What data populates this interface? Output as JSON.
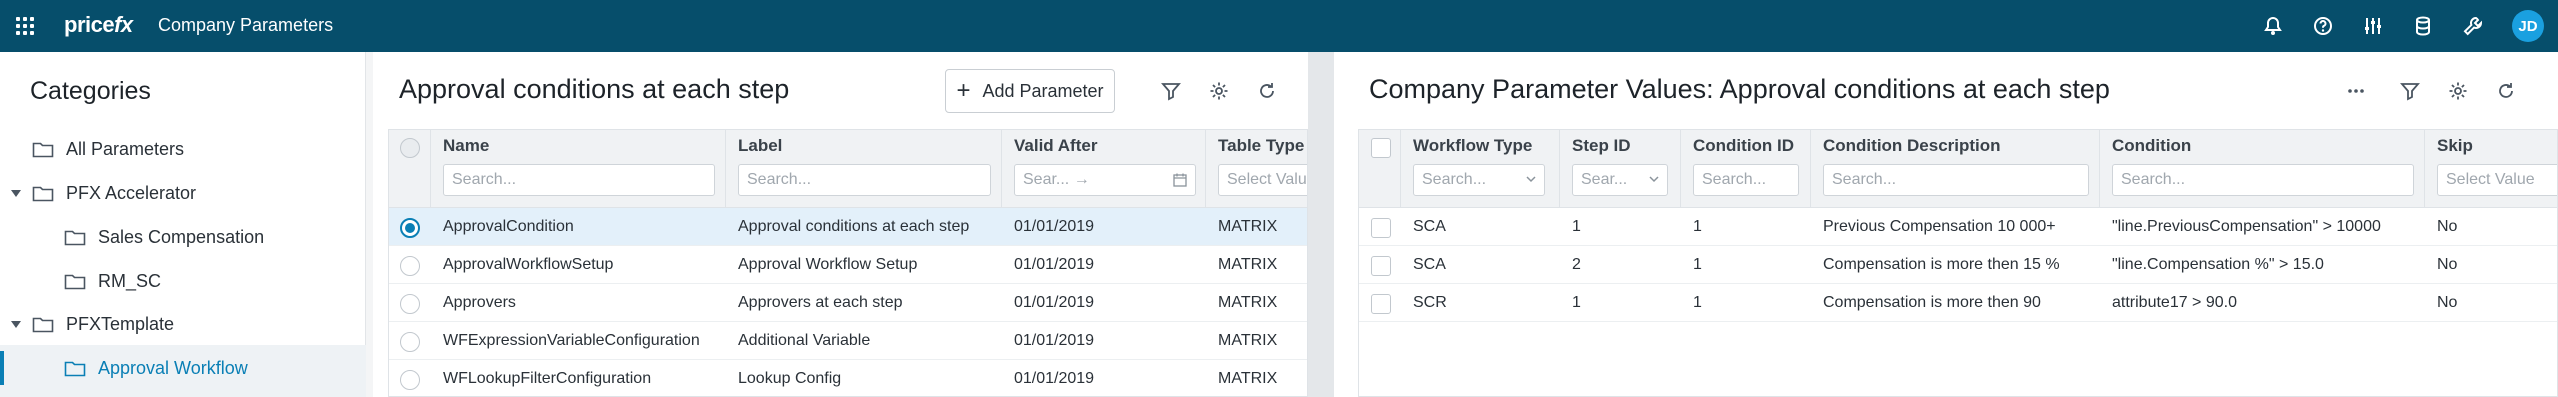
{
  "app": {
    "logo_text": "pricefx",
    "title": "Company Parameters",
    "user_initials": "JD"
  },
  "topbar_icons": [
    "bell-icon",
    "help-icon",
    "sliders-icon",
    "database-icon",
    "wrench-icon"
  ],
  "categories": {
    "title": "Categories",
    "items": [
      {
        "label": "All Parameters",
        "level": 0,
        "expandable": false
      },
      {
        "label": "PFX Accelerator",
        "level": 0,
        "expandable": true
      },
      {
        "label": "Sales Compensation",
        "level": 1,
        "expandable": false
      },
      {
        "label": "RM_SC",
        "level": 1,
        "expandable": false
      },
      {
        "label": "PFXTemplate",
        "level": 0,
        "expandable": true
      },
      {
        "label": "Approval Workflow",
        "level": 1,
        "expandable": false,
        "active": true
      }
    ]
  },
  "params_panel": {
    "title": "Approval conditions at each step",
    "add_label": "Add Parameter",
    "columns": {
      "name": {
        "title": "Name",
        "placeholder": "Search..."
      },
      "label": {
        "title": "Label",
        "placeholder": "Search..."
      },
      "valid_after": {
        "title": "Valid After",
        "placeholder": "Sear... →"
      },
      "table_type": {
        "title": "Table Type",
        "placeholder": "Select Value"
      }
    },
    "rows": [
      {
        "name": "ApprovalCondition",
        "label": "Approval conditions at each step",
        "valid_after": "01/01/2019",
        "type": "MATRIX",
        "selected": true
      },
      {
        "name": "ApprovalWorkflowSetup",
        "label": "Approval Workflow Setup",
        "valid_after": "01/01/2019",
        "type": "MATRIX",
        "selected": false
      },
      {
        "name": "Approvers",
        "label": "Approvers at each step",
        "valid_after": "01/01/2019",
        "type": "MATRIX",
        "selected": false
      },
      {
        "name": "WFExpressionVariableConfiguration",
        "label": "Additional Variable",
        "valid_after": "01/01/2019",
        "type": "MATRIX",
        "selected": false
      },
      {
        "name": "WFLookupFilterConfiguration",
        "label": "Lookup Config",
        "valid_after": "01/01/2019",
        "type": "MATRIX",
        "selected": false
      }
    ]
  },
  "values_panel": {
    "title": "Company Parameter Values: Approval conditions at each step",
    "columns": {
      "workflow_type": {
        "title": "Workflow Type",
        "placeholder": "Search..."
      },
      "step_id": {
        "title": "Step ID",
        "placeholder": "Sear..."
      },
      "condition_id": {
        "title": "Condition ID",
        "placeholder": "Search..."
      },
      "condition_description": {
        "title": "Condition Description",
        "placeholder": "Search..."
      },
      "condition": {
        "title": "Condition",
        "placeholder": "Search..."
      },
      "skip": {
        "title": "Skip",
        "placeholder": "Select Value"
      }
    },
    "rows": [
      {
        "workflow_type": "SCA",
        "step_id": "1",
        "condition_id": "1",
        "description": "Previous Compensation 10 000+",
        "condition": "\"line.PreviousCompensation\" > 10000",
        "skip": "No"
      },
      {
        "workflow_type": "SCA",
        "step_id": "2",
        "condition_id": "1",
        "description": "Compensation is more then 15 %",
        "condition": "\"line.Compensation %\" > 15.0",
        "skip": "No"
      },
      {
        "workflow_type": "SCR",
        "step_id": "1",
        "condition_id": "1",
        "description": "Compensation is more then 90",
        "condition": "attribute17 > 90.0",
        "skip": "No"
      }
    ]
  },
  "colors": {
    "topbar": "#064e6b",
    "accent": "#0a7fb5",
    "avatar": "#1aa0e0"
  }
}
